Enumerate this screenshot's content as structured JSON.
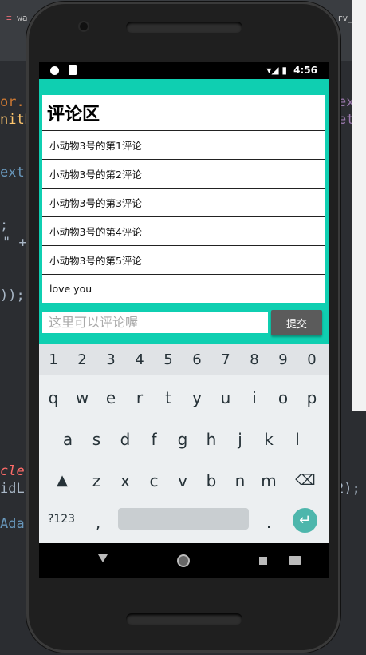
{
  "ide": {
    "tab_left": "wa",
    "tab_right": "rv_",
    "code_fragments": [
      "or.",
      "nitD",
      "ext",
      ";",
      "\" +",
      "));",
      "cle",
      "idLa",
      "Adap",
      "ex",
      "et",
      "2);"
    ]
  },
  "status_bar": {
    "time": "4:56",
    "icons": "▾◢ ▮"
  },
  "app": {
    "title": "评论区",
    "comments": [
      "小动物3号的第1评论",
      "小动物3号的第2评论",
      "小动物3号的第3评论",
      "小动物3号的第4评论",
      "小动物3号的第5评论",
      "love you"
    ],
    "input_placeholder": "这里可以评论喔",
    "submit_label": "提交",
    "accent_color": "#0fcfb1"
  },
  "keyboard": {
    "numbers": [
      "1",
      "2",
      "3",
      "4",
      "5",
      "6",
      "7",
      "8",
      "9",
      "0"
    ],
    "row1": [
      "q",
      "w",
      "e",
      "r",
      "t",
      "y",
      "u",
      "i",
      "o",
      "p"
    ],
    "row2": [
      "a",
      "s",
      "d",
      "f",
      "g",
      "h",
      "j",
      "k",
      "l"
    ],
    "row3": [
      "z",
      "x",
      "c",
      "v",
      "b",
      "n",
      "m"
    ],
    "symbols_key": "?123",
    "comma_key": ",",
    "period_key": ".",
    "shift_icon": "▲",
    "backspace_icon": "⌫",
    "enter_icon": "↵"
  }
}
